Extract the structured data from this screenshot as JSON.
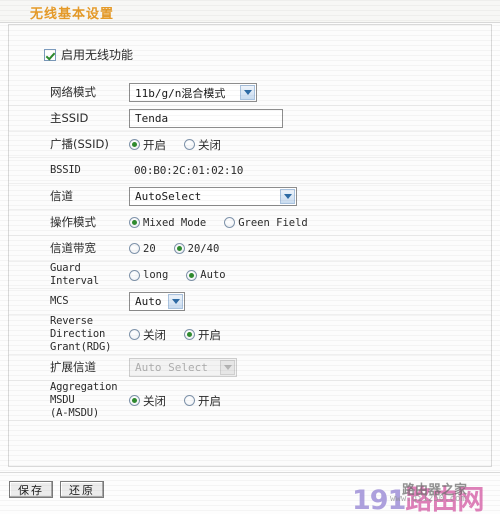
{
  "header": {
    "title": "无线基本设置"
  },
  "enable": {
    "label": "启用无线功能",
    "checked": "true"
  },
  "rows": {
    "network_mode": {
      "label": "网络模式",
      "value": "11b/g/n混合模式"
    },
    "main_ssid": {
      "label": "主SSID",
      "value": "Tenda"
    },
    "broadcast_ssid": {
      "label": "广播(SSID)",
      "on_label": "开启",
      "off_label": "关闭",
      "selected": "开启"
    },
    "bssid": {
      "label": "BSSID",
      "value": "00:B0:2C:01:02:10"
    },
    "channel": {
      "label": "信道",
      "value": "AutoSelect"
    },
    "operation_mode": {
      "label": "操作模式",
      "option1": "Mixed Mode",
      "option2": "Green Field",
      "selected": "Mixed Mode"
    },
    "channel_bandwidth": {
      "label": "信道带宽",
      "option1": "20",
      "option2": "20/40",
      "selected": "20/40"
    },
    "guard_interval": {
      "label": "Guard Interval",
      "option1": "long",
      "option2": "Auto",
      "selected": "Auto"
    },
    "mcs": {
      "label": "MCS",
      "value": "Auto"
    },
    "rdg": {
      "label": "Reverse Direction\nGrant(RDG)",
      "option1": "关闭",
      "option2": "开启",
      "selected": "开启"
    },
    "extension_channel": {
      "label": "扩展信道",
      "value": "Auto Select",
      "state": "disabled"
    },
    "amsdu": {
      "label": "Aggregation MSDU\n(A-MSDU)",
      "option1": "关闭",
      "option2": "开启",
      "selected": "关闭"
    }
  },
  "footer": {
    "save_label": "保存",
    "reset_label": "还原"
  },
  "watermark": {
    "number": "191",
    "text": "路由网",
    "overlay_text": "路由器之家",
    "overlay_sub": "www.qi1250.com"
  },
  "colors": {
    "title": "#e59a28",
    "radio_dot": "#2f8b2f",
    "watermark_pink": "#d661a8",
    "watermark_purple": "#9a8ad6"
  }
}
